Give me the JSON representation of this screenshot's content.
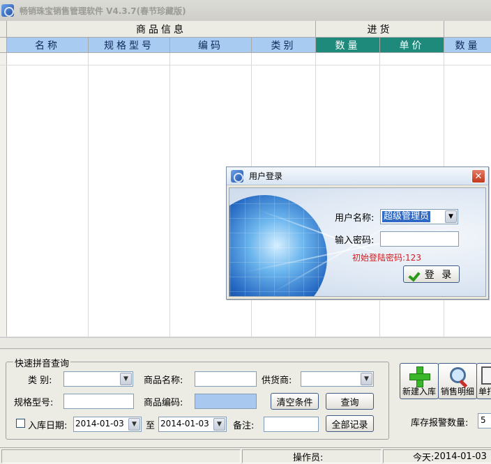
{
  "window": {
    "title": "畅销珠宝销售管理软件 V4.3.7(春节珍藏版)"
  },
  "grid": {
    "groups": [
      "商品信息",
      "进货"
    ],
    "columns": [
      "名称",
      "规格型号",
      "编码",
      "类别",
      "数量",
      "单价",
      "数量"
    ]
  },
  "search": {
    "legend": "快速拼音查询",
    "category_label": "类 别:",
    "category_value": "",
    "name_label": "商品名称:",
    "name_value": "",
    "supplier_label": "供货商:",
    "supplier_value": "",
    "spec_label": "规格型号:",
    "spec_value": "",
    "code_label": "商品编码:",
    "code_value": "",
    "clear_button": "清空条件",
    "query_button": "查询",
    "date_label": "入库日期:",
    "date_from": "2014-01-03",
    "date_to_label": "至",
    "date_to": "2014-01-03",
    "note_label": "备注:",
    "note_value": "",
    "all_button": "全部记录"
  },
  "actions": {
    "new_stock": "新建入库",
    "sales_detail": "销售明细",
    "print_partial": "单打"
  },
  "stock_alert": {
    "label": "库存报警数量:",
    "value": "5"
  },
  "status": {
    "operator_label": "操作员:",
    "today_label": "今天:",
    "today_value": "2014-01-03"
  },
  "login": {
    "title": "用户登录",
    "close_glyph": "✕",
    "username_label": "用户名称:",
    "username_value": "超级管理员",
    "password_label": "输入密码:",
    "password_value": "",
    "hint": "初始登陆密码:123",
    "login_button": "登 录"
  }
}
